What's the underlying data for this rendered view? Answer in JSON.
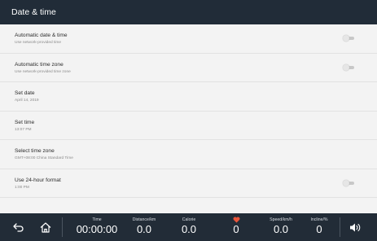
{
  "header": {
    "title": "Date & time"
  },
  "settings": [
    {
      "title": "Automatic date & time",
      "subtitle": "Use network-provided time",
      "toggle": "off"
    },
    {
      "title": "Automatic time zone",
      "subtitle": "Use network-provided time zone",
      "toggle": "off"
    },
    {
      "title": "Set date",
      "subtitle": "April 14, 2019"
    },
    {
      "title": "Set time",
      "subtitle": "13:07 PM"
    },
    {
      "title": "Select time zone",
      "subtitle": "GMT+08:00 China Standard Time"
    },
    {
      "title": "Use 24-hour format",
      "subtitle": "1:00 PM",
      "toggle": "off"
    }
  ],
  "bottom_bar": {
    "icons": {
      "back": "back-arrow-icon",
      "home": "home-icon",
      "heart": "heart-icon",
      "volume": "volume-icon"
    },
    "metrics": {
      "time": {
        "label": "Time",
        "value": "00:00:00"
      },
      "distance": {
        "label": "Distance/km",
        "value": "0.0"
      },
      "calorie": {
        "label": "Calorie",
        "value": "0.0"
      },
      "heart_rate": {
        "value": "0"
      },
      "speed": {
        "label": "Speed/km/h",
        "value": "0.0"
      },
      "incline": {
        "label": "Incline/%",
        "value": "0"
      }
    }
  },
  "colors": {
    "bar": "#222c37",
    "panel": "#f3f3f3",
    "heart": "#e8553a"
  }
}
